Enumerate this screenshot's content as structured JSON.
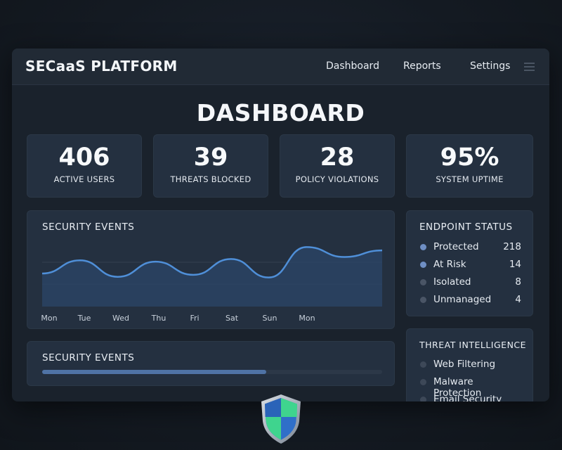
{
  "header": {
    "brand": "SECaaS PLATFORM",
    "nav": [
      {
        "label": "Dashboard"
      },
      {
        "label": "Reports"
      },
      {
        "label": "Settings"
      }
    ],
    "menu_icon": "hamburger-menu-icon"
  },
  "page_title": "DASHBOARD",
  "stats": [
    {
      "value": "406",
      "label": "ACTIVE USERS"
    },
    {
      "value": "39",
      "label": "THREATS BLOCKED"
    },
    {
      "value": "28",
      "label": "POLICY VIOLATIONS"
    },
    {
      "value": "95%",
      "label": "SYSTEM UPTIME"
    }
  ],
  "security_events_chart": {
    "title": "SECURITY EVENTS",
    "chart_data": {
      "type": "area",
      "categories": [
        "Mon",
        "Tue",
        "Wed",
        "Thu",
        "Fri",
        "Sat",
        "Sun",
        "Mon"
      ],
      "x": [
        0,
        1,
        2,
        3,
        4,
        5,
        6,
        7,
        8,
        9
      ],
      "values": [
        50,
        70,
        45,
        68,
        48,
        72,
        44,
        90,
        75,
        85
      ],
      "ylim": [
        0,
        100
      ],
      "grid": true,
      "line_color": "#4f8fd8",
      "fill_color": "#2b4668"
    }
  },
  "security_events_bar": {
    "title": "SECURITY EVENTS",
    "progress": 0.66,
    "fill_color": "#4f73a6"
  },
  "endpoint_status": {
    "title": "ENDPOINT STATUS",
    "items": [
      {
        "label": "Protected",
        "value": "218",
        "color": "#6f8fc4"
      },
      {
        "label": "At Risk",
        "value": "14",
        "color": "#6f8fc4"
      },
      {
        "label": "Isolated",
        "value": "8",
        "color": "#4a5566"
      },
      {
        "label": "Unmanaged",
        "value": "4",
        "color": "#4a5566"
      }
    ]
  },
  "threat_intelligence": {
    "title": "THREAT INTELLIGENCE",
    "items": [
      {
        "label": "Web Filtering",
        "color": "#3d4858"
      },
      {
        "label": "Malware Protection",
        "color": "#3d4858"
      },
      {
        "label": "Email Security",
        "color": "#3d4858"
      }
    ]
  },
  "logo": "shield-logo-icon"
}
